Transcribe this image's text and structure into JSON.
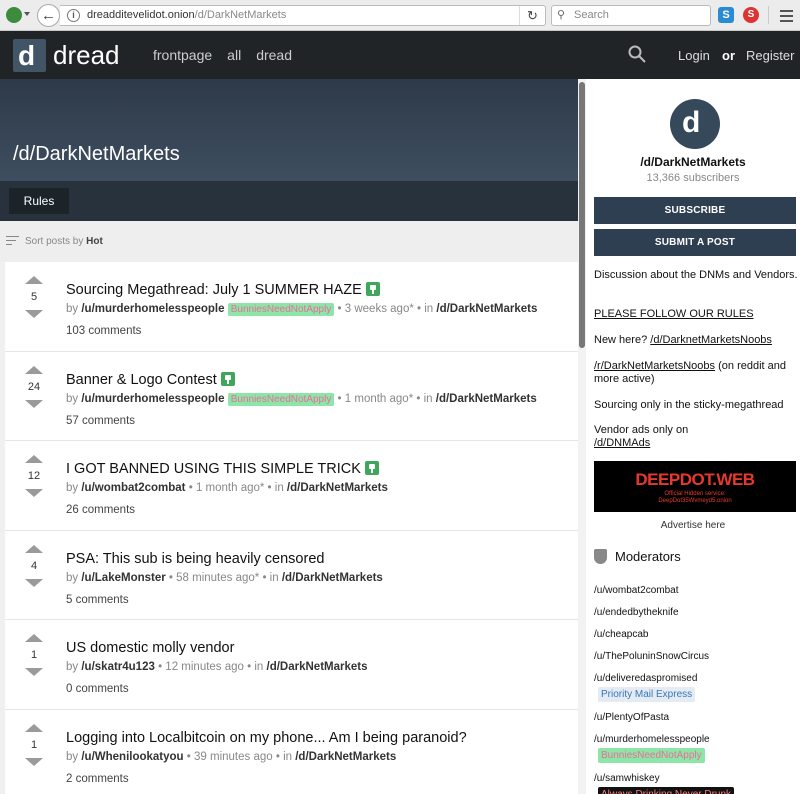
{
  "browser": {
    "url_host": "dreadditevelidot.onion",
    "url_path": "/d/DarkNetMarkets",
    "search_placeholder": "Search"
  },
  "header": {
    "brand": "dread",
    "nav": [
      "frontpage",
      "all",
      "dread"
    ],
    "login": "Login",
    "or": "or",
    "register": "Register"
  },
  "banner": {
    "title": "/d/DarkNetMarkets",
    "tab": "Rules"
  },
  "sort": {
    "prefix": "Sort posts by",
    "value": "Hot"
  },
  "posts": [
    {
      "score": "5",
      "title": "Sourcing Megathread: July 1 SUMMER HAZE",
      "pinned": true,
      "by": "by",
      "user": "/u/murderhomelesspeople",
      "flair": "BunniesNeedNotApply",
      "time": "• 3 weeks ago* • in",
      "sub": "/d/DarkNetMarkets",
      "comments": "103 comments"
    },
    {
      "score": "24",
      "title": "Banner & Logo Contest",
      "pinned": true,
      "by": "by",
      "user": "/u/murderhomelesspeople",
      "flair": "BunniesNeedNotApply",
      "time": "• 1 month ago* • in",
      "sub": "/d/DarkNetMarkets",
      "comments": "57 comments"
    },
    {
      "score": "12",
      "title": "I GOT BANNED USING THIS SIMPLE TRICK",
      "pinned": true,
      "by": "by",
      "user": "/u/wombat2combat",
      "flair": "",
      "time": "• 1 month ago* • in",
      "sub": "/d/DarkNetMarkets",
      "comments": "26 comments"
    },
    {
      "score": "4",
      "title": "PSA: This sub is being heavily censored",
      "pinned": false,
      "by": "by",
      "user": "/u/LakeMonster",
      "flair": "",
      "time": "• 58 minutes ago* • in",
      "sub": "/d/DarkNetMarkets",
      "comments": "5 comments"
    },
    {
      "score": "1",
      "title": "US domestic molly vendor",
      "pinned": false,
      "by": "by",
      "user": "/u/skatr4u123",
      "flair": "",
      "time": "• 12 minutes ago • in",
      "sub": "/d/DarkNetMarkets",
      "comments": "0 comments"
    },
    {
      "score": "1",
      "title": "Logging into Localbitcoin on my phone... Am I being paranoid?",
      "pinned": false,
      "by": "by",
      "user": "/u/Whenilookatyou",
      "flair": "",
      "time": "• 39 minutes ago • in",
      "sub": "/d/DarkNetMarkets",
      "comments": "2 comments"
    }
  ],
  "sidebar": {
    "name": "/d/DarkNetMarkets",
    "subscribers": "13,366 subscribers",
    "subscribe": "SUBSCRIBE",
    "submit": "SUBMIT A POST",
    "desc": "Discussion about the DNMs and Vendors.",
    "rules_link": "PLEASE FOLLOW OUR RULES",
    "newhere_text": "New here?",
    "newhere_link": "/d/DarknetMarketsNoobs",
    "reddit_link": "/r/DarkNetMarketsNoobs",
    "reddit_text": "(on reddit and more active)",
    "sourcing": "Sourcing only in the sticky-megathread",
    "vendor_text": "Vendor ads only on",
    "vendor_link": "/d/DNMAds",
    "ad_title": "DEEPDOT.WEB",
    "ad_line1": "Official Hidden service:",
    "ad_line2": "DeepDot35Wvmeyd5.onion",
    "advertise": "Advertise here",
    "mod_heading": "Moderators",
    "mods": [
      {
        "name": "/u/wombat2combat",
        "flair": "",
        "style": ""
      },
      {
        "name": "/u/endedbytheknife",
        "flair": "",
        "style": ""
      },
      {
        "name": "/u/cheapcab",
        "flair": "",
        "style": ""
      },
      {
        "name": "/u/ThePoluninSnowCircus",
        "flair": "",
        "style": ""
      },
      {
        "name": "/u/deliveredaspromised",
        "flair": "Priority Mail Express",
        "style": "blue"
      },
      {
        "name": "/u/PlentyOfPasta",
        "flair": "",
        "style": ""
      },
      {
        "name": "/u/murderhomelesspeople",
        "flair": "BunniesNeedNotApply",
        "style": "green"
      },
      {
        "name": "/u/samwhiskey",
        "flair": "Always Drinking Never Drunk",
        "style": "dark"
      }
    ]
  }
}
